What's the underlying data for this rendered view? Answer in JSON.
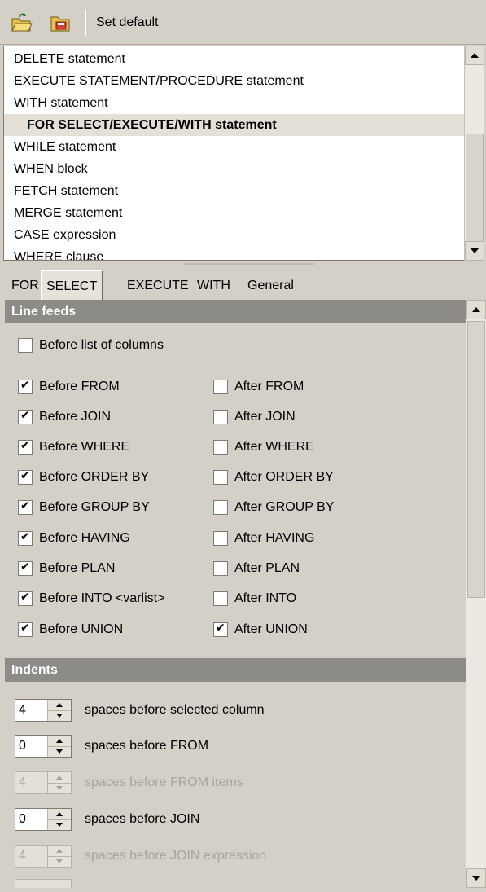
{
  "toolbar": {
    "icons": [
      "folder-open-icon",
      "folder-save-icon"
    ],
    "set_default_label": "Set default"
  },
  "statement_list": {
    "items": [
      {
        "label": "DELETE statement"
      },
      {
        "label": "EXECUTE STATEMENT/PROCEDURE statement"
      },
      {
        "label": "WITH statement"
      },
      {
        "label": "FOR SELECT/EXECUTE/WITH statement",
        "selected": true
      },
      {
        "label": "WHILE statement"
      },
      {
        "label": "WHEN block"
      },
      {
        "label": "FETCH statement"
      },
      {
        "label": "MERGE statement"
      },
      {
        "label": "CASE expression"
      },
      {
        "label": "WHERE clause"
      }
    ]
  },
  "tabs": [
    {
      "label": "FOR"
    },
    {
      "label": "SELECT",
      "active": true
    },
    {
      "label": "EXECUTE"
    },
    {
      "label": "WITH"
    },
    {
      "label": "General"
    }
  ],
  "line_feeds": {
    "header": "Line feeds",
    "before_list_of_columns": {
      "label": "Before list of columns",
      "checked": false
    },
    "pairs": [
      {
        "before": {
          "label": "Before FROM",
          "checked": true
        },
        "after": {
          "label": "After FROM",
          "checked": false
        }
      },
      {
        "before": {
          "label": "Before JOIN",
          "checked": true
        },
        "after": {
          "label": "After JOIN",
          "checked": false
        }
      },
      {
        "before": {
          "label": "Before WHERE",
          "checked": true
        },
        "after": {
          "label": "After WHERE",
          "checked": false
        }
      },
      {
        "before": {
          "label": "Before ORDER BY",
          "checked": true
        },
        "after": {
          "label": "After ORDER BY",
          "checked": false
        }
      },
      {
        "before": {
          "label": "Before GROUP BY",
          "checked": true
        },
        "after": {
          "label": "After GROUP BY",
          "checked": false
        }
      },
      {
        "before": {
          "label": "Before HAVING",
          "checked": true
        },
        "after": {
          "label": "After HAVING",
          "checked": false
        }
      },
      {
        "before": {
          "label": "Before PLAN",
          "checked": true
        },
        "after": {
          "label": "After PLAN",
          "checked": false
        }
      },
      {
        "before": {
          "label": "Before INTO <varlist>",
          "checked": true
        },
        "after": {
          "label": "After INTO",
          "checked": false
        }
      },
      {
        "before": {
          "label": "Before UNION",
          "checked": true
        },
        "after": {
          "label": "After UNION",
          "checked": true
        }
      }
    ]
  },
  "indents": {
    "header": "Indents",
    "rows": [
      {
        "value": "4",
        "label": "spaces before selected column",
        "enabled": true
      },
      {
        "value": "0",
        "label": "spaces before FROM",
        "enabled": true
      },
      {
        "value": "4",
        "label": "spaces before FROM items",
        "enabled": false
      },
      {
        "value": "0",
        "label": "spaces before JOIN",
        "enabled": true
      },
      {
        "value": "4",
        "label": "spaces before JOIN expression",
        "enabled": false
      }
    ]
  }
}
